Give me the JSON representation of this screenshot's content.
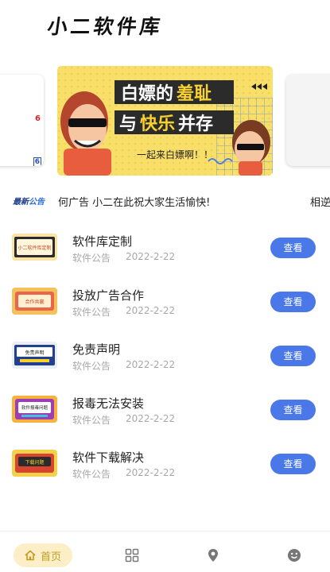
{
  "header": {
    "title": "小二软件库"
  },
  "carousel": {
    "left_fragment_1": "6",
    "left_fragment_2": "6",
    "banner": {
      "line1_a": "白嫖的",
      "line1_b": "羞耻",
      "line2_a": "与",
      "line2_b": "快乐",
      "line2_c": "并存",
      "subtitle": "一起来白嫖啊！！"
    }
  },
  "notice": {
    "badge_a": "最新",
    "badge_b": "公告",
    "text": "何广告  小二在此祝大家生活愉快!",
    "next": "相逆"
  },
  "list": {
    "items": [
      {
        "title": "软件库定制",
        "category": "软件公告",
        "date": "2022-2-22",
        "button": "查看",
        "thumb_text": "小二软件库定制",
        "thumb_color": "#fbe3a3"
      },
      {
        "title": "投放广告合作",
        "category": "软件公告",
        "date": "2022-2-22",
        "button": "查看",
        "thumb_text": "合作共赢",
        "thumb_color": "#f4c15a"
      },
      {
        "title": "免责声明",
        "category": "软件公告",
        "date": "2022-2-22",
        "button": "查看",
        "thumb_text": "免责声明",
        "thumb_color": "#e9eef7"
      },
      {
        "title": "报毒无法安装",
        "category": "软件公告",
        "date": "2022-2-22",
        "button": "查看",
        "thumb_text": "软件报毒问题",
        "thumb_color": "#f6b23c"
      },
      {
        "title": "软件下载解决",
        "category": "软件公告",
        "date": "2022-2-22",
        "button": "查看",
        "thumb_text": "下载问题",
        "thumb_color": "#f2d24a"
      }
    ]
  },
  "bottom_nav": {
    "home_label": "首页",
    "home_icon": "home-icon",
    "icons": [
      "grid-icon",
      "location-pin-icon",
      "smiley-icon"
    ],
    "accent_color": "#c59a1d",
    "accent_bg": "#fcefc7"
  },
  "colors": {
    "button": "#4a78e8",
    "muted": "#a8a8a8"
  }
}
